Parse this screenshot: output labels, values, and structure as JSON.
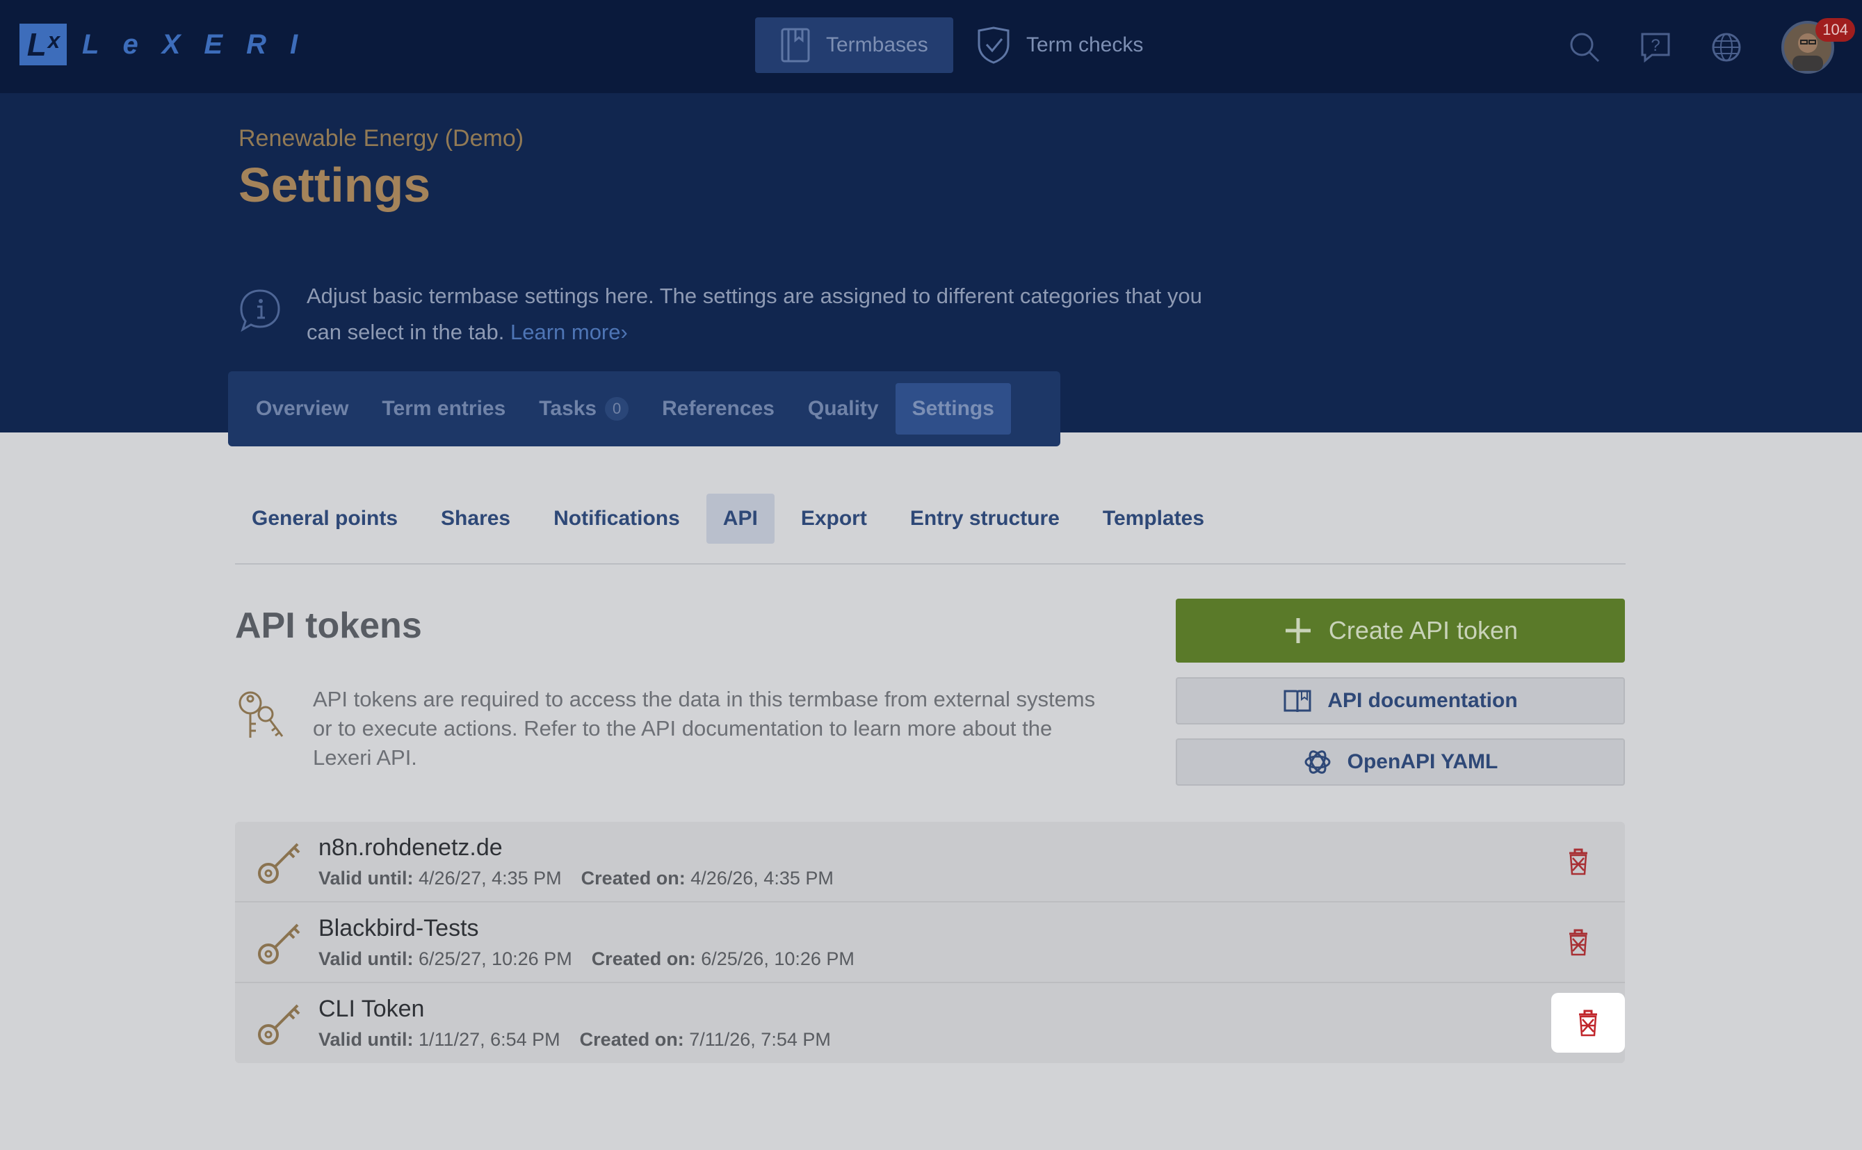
{
  "topbar": {
    "logo_mark": "Lˣ",
    "logo_letters": [
      "L",
      "e",
      "X",
      "E",
      "R",
      "I"
    ],
    "nav": [
      {
        "label": "Termbases",
        "icon": "book-icon",
        "active": true
      },
      {
        "label": "Term checks",
        "icon": "shield-check-icon",
        "active": false
      }
    ],
    "icons": [
      "search-icon",
      "help-icon",
      "globe-icon"
    ],
    "notification_count": "104"
  },
  "header": {
    "breadcrumb": "Renewable Energy (Demo)",
    "title": "Settings",
    "info_text": "Adjust basic termbase settings here. The settings are assigned to different categories that you can select in the tab.",
    "learn_more": "Learn more"
  },
  "tabs": [
    {
      "label": "Overview",
      "active": false
    },
    {
      "label": "Term entries",
      "active": false
    },
    {
      "label": "Tasks",
      "count": "0",
      "active": false
    },
    {
      "label": "References",
      "active": false
    },
    {
      "label": "Quality",
      "active": false
    },
    {
      "label": "Settings",
      "active": true
    }
  ],
  "subtabs": [
    {
      "label": "General points",
      "active": false
    },
    {
      "label": "Shares",
      "active": false
    },
    {
      "label": "Notifications",
      "active": false
    },
    {
      "label": "API",
      "active": true
    },
    {
      "label": "Export",
      "active": false
    },
    {
      "label": "Entry structure",
      "active": false
    },
    {
      "label": "Templates",
      "active": false
    }
  ],
  "api": {
    "title": "API tokens",
    "description": "API tokens are required to access the data in this termbase from external systems or to execute actions. Refer to the API documentation to learn more about the Lexeri API.",
    "create_button": "Create API token",
    "docs_button": "API documentation",
    "yaml_button": "OpenAPI YAML",
    "valid_label": "Valid until:",
    "created_label": "Created on:",
    "tokens": [
      {
        "name": "n8n.rohdenetz.de",
        "valid_until": "4/26/27, 4:35 PM",
        "created_on": "4/26/26, 4:35 PM"
      },
      {
        "name": "Blackbird-Tests",
        "valid_until": "6/25/27, 10:26 PM",
        "created_on": "6/25/26, 10:26 PM"
      },
      {
        "name": "CLI Token",
        "valid_until": "1/11/27, 6:54 PM",
        "created_on": "7/11/26, 7:54 PM"
      }
    ]
  },
  "colors": {
    "accent_gold": "#a4835a",
    "primary_blue": "#2e4877",
    "create_green": "#5a7a29",
    "delete_red": "#c0262b"
  }
}
